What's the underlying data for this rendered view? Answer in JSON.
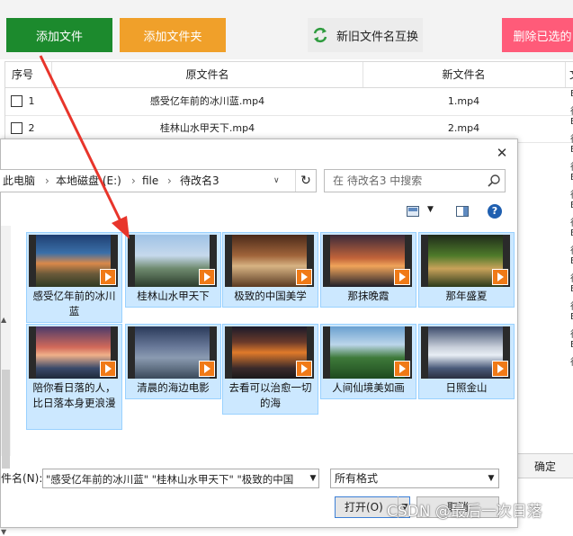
{
  "toolbar": {
    "add_file": "添加文件",
    "add_folder": "添加文件夹",
    "swap_names": "新旧文件名互换",
    "delete_done": "删除已选的"
  },
  "table": {
    "headers": {
      "index": "序号",
      "original": "原文件名",
      "new": "新文件名",
      "extra": "文"
    },
    "rows": [
      {
        "index": "1",
        "original": "感受亿年前的冰川蓝.mp4",
        "new": "1.mp4"
      },
      {
        "index": "2",
        "original": "桂林山水甲天下.mp4",
        "new": "2.mp4"
      }
    ],
    "side_marks": [
      "E",
      "徉",
      "E",
      "徉",
      "E",
      "徉",
      "E",
      "徉",
      "E",
      "徉",
      "E",
      "徉",
      "E",
      "徉",
      "E",
      "徉",
      "E",
      "徉",
      "E",
      "徉"
    ]
  },
  "confirm_label": "确定",
  "dialog": {
    "close": "✕",
    "breadcrumb": [
      "此电脑",
      "本地磁盘 (E:)",
      "file",
      "待改名3"
    ],
    "search_placeholder": "在 待改名3 中搜索",
    "tiles": [
      {
        "label": "感受亿年前的冰川蓝"
      },
      {
        "label": "桂林山水甲天下"
      },
      {
        "label": "极致的中国美学"
      },
      {
        "label": "那抹晚霞"
      },
      {
        "label": "那年盛夏"
      },
      {
        "label": "陪你看日落的人，比日落本身更浪漫"
      },
      {
        "label": "清晨的海边电影"
      },
      {
        "label": "去看可以治愈一切的海"
      },
      {
        "label": "人间仙境美如画"
      },
      {
        "label": "日照金山"
      }
    ],
    "filename_label": "件名(N):",
    "filename_value": "\"感受亿年前的冰川蓝\" \"桂林山水甲天下\" \"极致的中国",
    "filter_value": "所有格式",
    "open_label": "打开(O)",
    "cancel_label": "取消"
  },
  "watermark": "CSDN @最后一次日落",
  "colors": {
    "add": "#1c8a2d",
    "folder": "#f0a02a",
    "delete": "#ff5b79",
    "selection": "#cce8ff",
    "arrow": "#e8352b"
  }
}
